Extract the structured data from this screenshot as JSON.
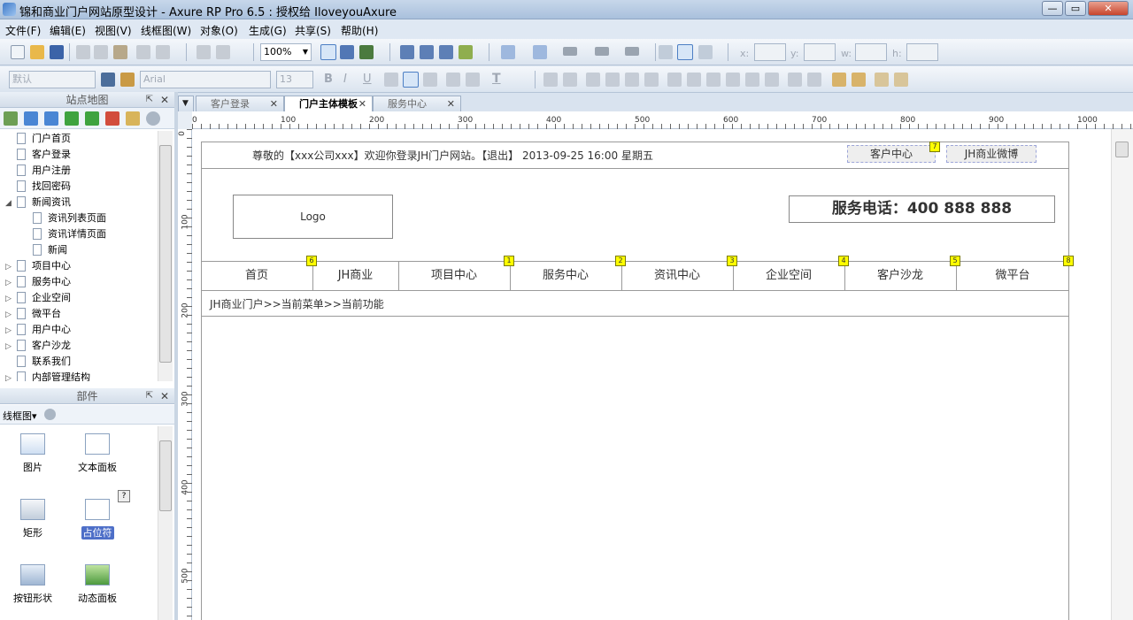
{
  "window": {
    "title": "锦和商业门户网站原型设计 - Axure RP Pro 6.5 : 授权给 IloveyouAxure",
    "min": "—",
    "max": "▭",
    "close": "✕"
  },
  "menubar": [
    "文件(F)",
    "编辑(E)",
    "视图(V)",
    "线框图(W)",
    "对象(O)",
    "生成(G)",
    "共享(S)",
    "帮助(H)"
  ],
  "toolbar1": {
    "zoom": "100%",
    "x_label": "x:",
    "y_label": "y:",
    "w_label": "w:",
    "h_label": "h:"
  },
  "toolbar2": {
    "style_value": "默认",
    "font_value": "Arial",
    "size_value": "13",
    "bold": "B",
    "italic": "I",
    "underline": "U",
    "textcolor": "T"
  },
  "sitemap": {
    "title": "站点地图",
    "pin": "⇱",
    "close": "✕",
    "items": [
      {
        "label": "门户首页",
        "level": 1,
        "arrow": ""
      },
      {
        "label": "客户登录",
        "level": 1,
        "arrow": ""
      },
      {
        "label": "用户注册",
        "level": 1,
        "arrow": ""
      },
      {
        "label": "找回密码",
        "level": 1,
        "arrow": ""
      },
      {
        "label": "新闻资讯",
        "level": 1,
        "arrow": "◢"
      },
      {
        "label": "资讯列表页面",
        "level": 2,
        "arrow": ""
      },
      {
        "label": "资讯详情页面",
        "level": 2,
        "arrow": ""
      },
      {
        "label": "新闻",
        "level": 2,
        "arrow": ""
      },
      {
        "label": "项目中心",
        "level": 1,
        "arrow": "▷"
      },
      {
        "label": "服务中心",
        "level": 1,
        "arrow": "▷"
      },
      {
        "label": "企业空间",
        "level": 1,
        "arrow": "▷"
      },
      {
        "label": "微平台",
        "level": 1,
        "arrow": "▷"
      },
      {
        "label": "用户中心",
        "level": 1,
        "arrow": "▷"
      },
      {
        "label": "客户沙龙",
        "level": 1,
        "arrow": "▷"
      },
      {
        "label": "联系我们",
        "level": 1,
        "arrow": ""
      },
      {
        "label": "内部管理结构",
        "level": 1,
        "arrow": "▷"
      }
    ]
  },
  "widgets": {
    "title": "部件",
    "library": "线框图▾",
    "items": [
      "图片",
      "文本面板",
      "矩形",
      "占位符",
      "按钮形状",
      "动态面板"
    ],
    "help": "?"
  },
  "tabs": [
    {
      "label": "客户登录",
      "close": "✕"
    },
    {
      "label": "门户主体模板",
      "close": "✕"
    },
    {
      "label": "服务中心",
      "close": "✕"
    }
  ],
  "ruler": {
    "h": [
      "0",
      "100",
      "200",
      "300",
      "400",
      "500",
      "600",
      "700",
      "800",
      "900",
      "1000"
    ],
    "v": [
      "0",
      "100",
      "200",
      "300",
      "400",
      "500"
    ]
  },
  "canvas": {
    "welcome": "尊敬的【xxx公司xxx】欢迎你登录JH门户网站。【退出】     2013-09-25 16:00    星期五",
    "top_links": [
      "客户中心",
      "JH商业微博"
    ],
    "logo": "Logo",
    "phone": "服务电话：400 888 888",
    "nav": [
      "首页",
      "JH商业",
      "项目中心",
      "服务中心",
      "资讯中心",
      "企业空间",
      "客户沙龙",
      "微平台"
    ],
    "badges": [
      "6",
      "1",
      "2",
      "3",
      "4",
      "5",
      "8",
      "7"
    ],
    "breadcrumb": "JH商业门户>>当前菜单>>当前功能"
  }
}
